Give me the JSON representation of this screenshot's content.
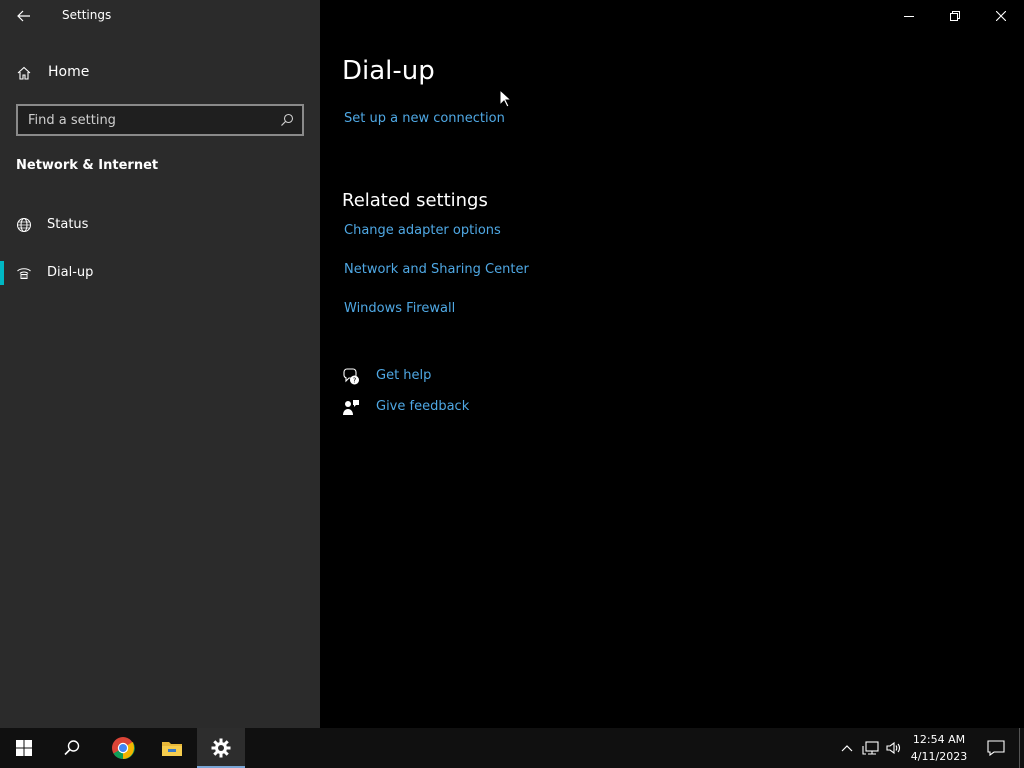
{
  "window": {
    "app_title": "Settings"
  },
  "sidebar": {
    "home_label": "Home",
    "search_placeholder": "Find a setting",
    "section_title": "Network & Internet",
    "items": [
      {
        "label": "Status",
        "icon": "globe-icon",
        "active": false
      },
      {
        "label": "Dial-up",
        "icon": "phone-icon",
        "active": true
      }
    ]
  },
  "main": {
    "title": "Dial-up",
    "setup_link": "Set up a new connection",
    "related_title": "Related settings",
    "related_links": [
      "Change adapter options",
      "Network and Sharing Center",
      "Windows Firewall"
    ],
    "help_link": "Get help",
    "feedback_link": "Give feedback"
  },
  "taskbar": {
    "time": "12:54 AM",
    "date": "4/11/2023"
  },
  "colors": {
    "sidebar_bg": "#2b2b2b",
    "main_bg": "#000000",
    "link": "#4fa8e4",
    "accent": "#00b7c3",
    "taskbar_bg": "#101010"
  }
}
